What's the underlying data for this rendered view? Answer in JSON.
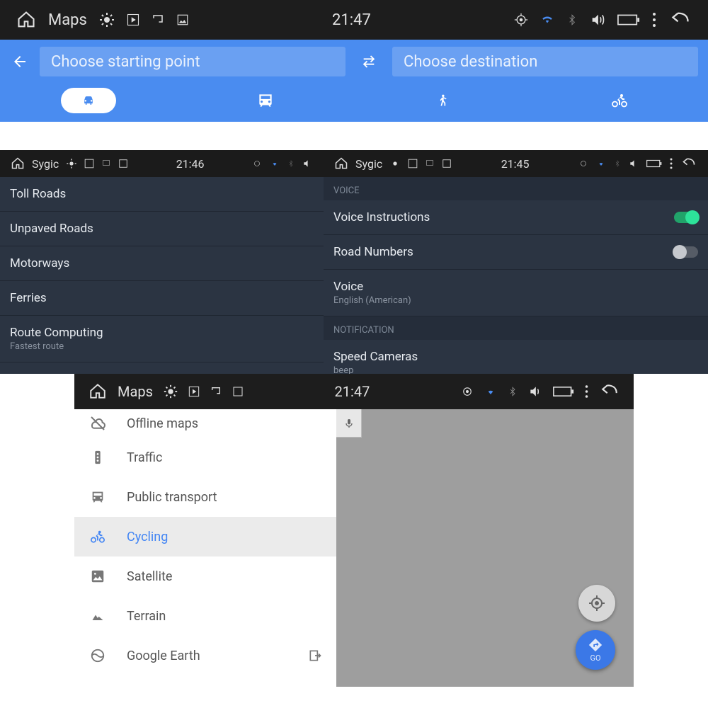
{
  "panel1": {
    "status": {
      "app": "Maps",
      "time": "21:47"
    },
    "start_placeholder": "Choose starting point",
    "dest_placeholder": "Choose destination"
  },
  "panel2": {
    "status": {
      "app": "Sygic",
      "time": "21:46"
    },
    "rows": [
      {
        "title": "Toll Roads"
      },
      {
        "title": "Unpaved Roads"
      },
      {
        "title": "Motorways"
      },
      {
        "title": "Ferries"
      },
      {
        "title": "Route Computing",
        "sub": "Fastest route"
      }
    ]
  },
  "panel3": {
    "status": {
      "app": "Sygic",
      "time": "21:45"
    },
    "voice_header": "VOICE",
    "rows": [
      {
        "title": "Voice Instructions",
        "toggle": "on"
      },
      {
        "title": "Road Numbers",
        "toggle": "off"
      },
      {
        "title": "Voice",
        "sub": "English (American)"
      }
    ],
    "notif_header": "NOTIFICATION",
    "notif_row": {
      "title": "Speed Cameras",
      "sub": "beep"
    }
  },
  "panel4": {
    "status": {
      "app": "Maps",
      "time": "21:47"
    },
    "items": [
      {
        "label": "Offline maps"
      },
      {
        "label": "Traffic"
      },
      {
        "label": "Public transport"
      },
      {
        "label": "Cycling",
        "selected": true
      },
      {
        "label": "Satellite"
      },
      {
        "label": "Terrain"
      },
      {
        "label": "Google Earth",
        "exit": true
      }
    ],
    "go_label": "GO"
  }
}
